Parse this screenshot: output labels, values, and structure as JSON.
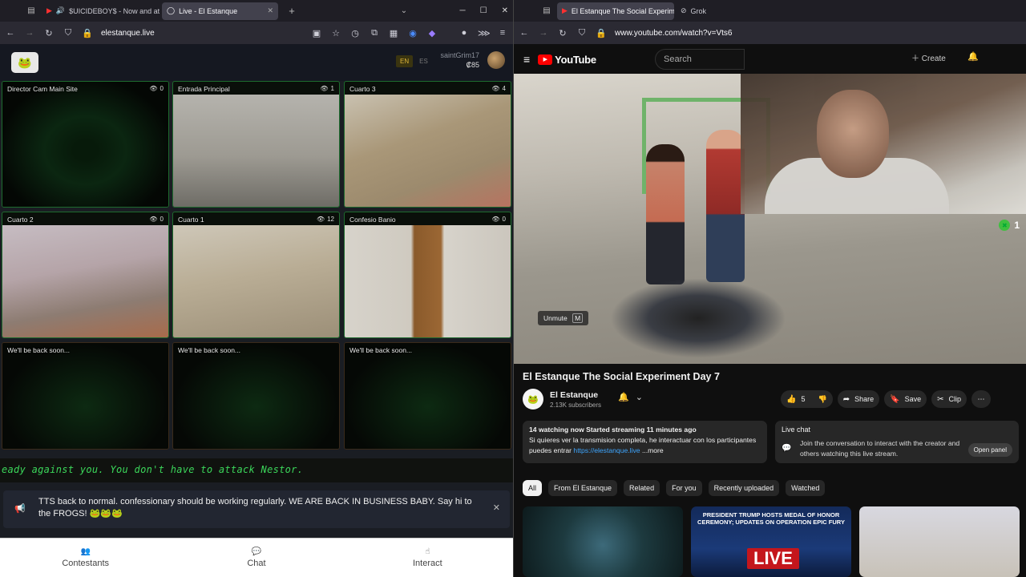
{
  "left_browser": {
    "tabs": [
      {
        "title": "$UICIDEBOY$ - Now and at"
      },
      {
        "title": "Live - El Estanque"
      }
    ],
    "url": "elestanque.live"
  },
  "site": {
    "lang_active": "EN",
    "lang_other": "ES",
    "username": "saintGrim17",
    "coins": "₡85",
    "cams": [
      {
        "title": "Director Cam Main Site",
        "viewers": "0"
      },
      {
        "title": "Entrada Principal",
        "viewers": "1"
      },
      {
        "title": "Cuarto 3",
        "viewers": "4"
      },
      {
        "title": "Cuarto 2",
        "viewers": "0"
      },
      {
        "title": "Cuarto 1",
        "viewers": "12"
      },
      {
        "title": "Confesio Banio",
        "viewers": "0"
      },
      {
        "title": "We'll be back soon..."
      },
      {
        "title": "We'll be back soon..."
      },
      {
        "title": "We'll be back soon..."
      }
    ],
    "ticker": "eady against you. You don't have to attack Nestor.",
    "announcement": "TTS back to normal. confessionary should be working regularly. WE ARE BACK IN BUSINESS BABY. Say hi to the FROGS! 🐸🐸🐸",
    "nav": {
      "contestants": "Contestants",
      "chat": "Chat",
      "interact": "Interact"
    }
  },
  "right_browser": {
    "tabs": [
      {
        "title": "El Estanque The Social Experim"
      },
      {
        "title": "Grok"
      }
    ],
    "url": "www.youtube.com/watch?v=Vts6"
  },
  "youtube": {
    "logo": "YouTube",
    "search_placeholder": "Search",
    "create": "Create",
    "overlay_count": "1",
    "unmute": "Unmute",
    "unmute_key": "M",
    "title": "El Estanque The Social Experiment Day 7",
    "channel": "El Estanque",
    "subscribers": "2.13K subscribers",
    "likes": "5",
    "share": "Share",
    "save": "Save",
    "clip": "Clip",
    "description": {
      "stats": "14 watching now  Started streaming 11 minutes ago",
      "line": "Si quieres ver la transmision completa, he interactuar con los participantes puedes entrar",
      "link": "https://elestanque.live",
      "more": "...more"
    },
    "live_chat": {
      "title": "Live chat",
      "body": "Join the conversation to interact with the creator and others watching this live stream.",
      "button": "Open panel"
    },
    "chips": [
      "All",
      "From El Estanque",
      "Related",
      "For you",
      "Recently uploaded",
      "Watched"
    ],
    "thumb2_headline": "PRESIDENT TRUMP HOSTS MEDAL OF HONOR CEREMONY; UPDATES ON OPERATION EPIC FURY",
    "thumb2_live": "LIVE"
  }
}
